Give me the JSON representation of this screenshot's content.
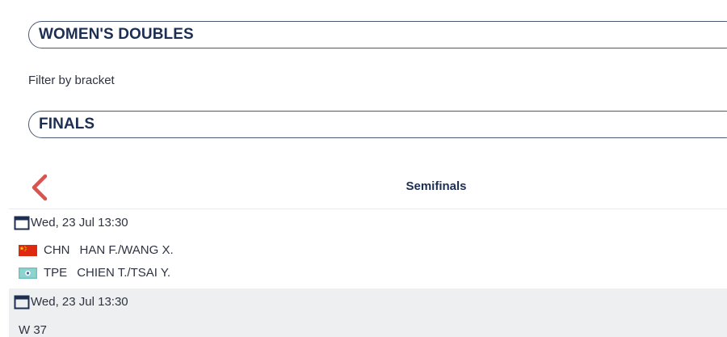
{
  "event_select": {
    "value": "WOMEN'S DOUBLES"
  },
  "filter_label": "Filter by bracket",
  "bracket_select": {
    "value": "FINALS"
  },
  "round_nav": {
    "title": "Semifinals",
    "prev_icon": "chevron-left-icon",
    "accent": "#d9534f"
  },
  "matches": [
    {
      "date": "Wed, 23 Jul  13:30",
      "teams": [
        {
          "code": "CHN",
          "players": "HAN F./WANG X.",
          "flag": "china-flag-icon"
        },
        {
          "code": "TPE",
          "players": "CHIEN T./TSAI Y.",
          "flag": "chinese-taipei-flag-icon"
        }
      ]
    },
    {
      "date": "Wed, 23 Jul  13:30",
      "placeholder": "W 37"
    }
  ]
}
